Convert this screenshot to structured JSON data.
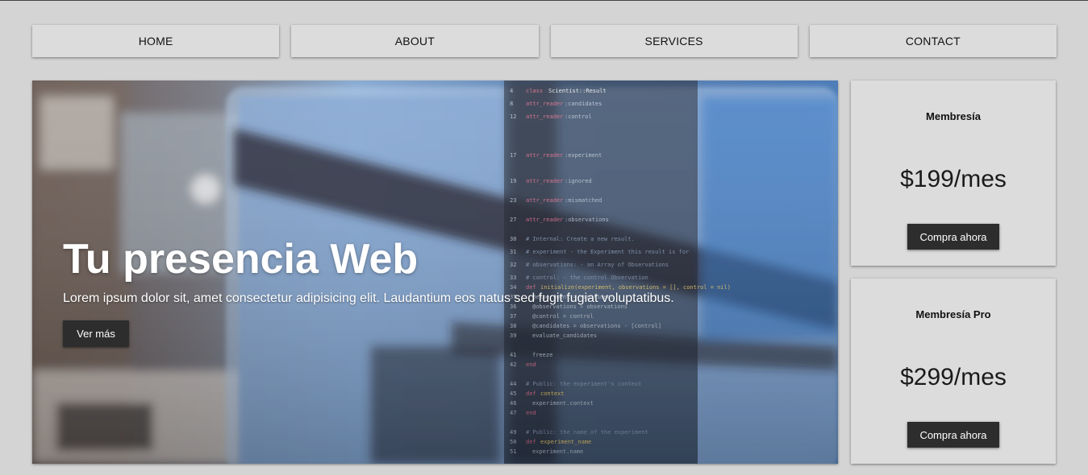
{
  "nav": {
    "items": [
      {
        "label": "HOME"
      },
      {
        "label": "ABOUT"
      },
      {
        "label": "SERVICES"
      },
      {
        "label": "CONTACT"
      }
    ]
  },
  "hero": {
    "title": "Tu presencia Web",
    "text": "Lorem ipsum dolor sit, amet consectetur adipisicing elit. Laudantium eos natus sed fugit fugiat voluptatibus.",
    "button_label": "Ver más"
  },
  "pricing": [
    {
      "title": "Membresía",
      "price": "$199/mes",
      "button_label": "Compra ahora"
    },
    {
      "title": "Membresía Pro",
      "price": "$299/mes",
      "button_label": "Compra ahora"
    }
  ],
  "colors": {
    "page_bg": "#d4d4d4",
    "nav_bg": "#dcdcdc",
    "button_bg": "#2d2d2d",
    "button_text": "#ffffff"
  }
}
